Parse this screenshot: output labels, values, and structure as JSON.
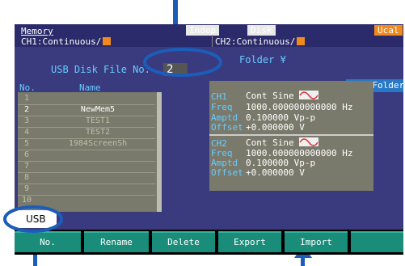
{
  "topbar": {
    "memory_label": "Memory",
    "indep_label": "Indep",
    "disk_label": "Disk",
    "ucal_label": "Ucal",
    "ch1_label": "CH1:Continuous/",
    "ch2_label": "CH2:Continuous/"
  },
  "header": {
    "title": "USB Disk File No.",
    "file_no": "2",
    "folder_label": "Folder ¥"
  },
  "file_table": {
    "col_no": "No.",
    "col_name": "Name",
    "rows": [
      {
        "no": "1",
        "name": ""
      },
      {
        "no": "2",
        "name": "NewMem5"
      },
      {
        "no": "3",
        "name": "TEST1"
      },
      {
        "no": "4",
        "name": "TEST2"
      },
      {
        "no": "5",
        "name": "1984ScreenSh"
      },
      {
        "no": "6",
        "name": ""
      },
      {
        "no": "7",
        "name": ""
      },
      {
        "no": "8",
        "name": ""
      },
      {
        "no": "9",
        "name": ""
      },
      {
        "no": "10",
        "name": ""
      }
    ]
  },
  "new_folder_label": "New Folder",
  "info": {
    "ch1": {
      "label": "CH1",
      "value": "Cont Sine"
    },
    "ch1_freq": {
      "label": "Freq",
      "value": "1000.000000000000 Hz"
    },
    "ch1_amptd": {
      "label": "Amptd",
      "value": "0.100000 Vp-p"
    },
    "ch1_offset": {
      "label": "Offset",
      "value": "+0.000000 V"
    },
    "ch2": {
      "label": "CH2",
      "value": "Cont Sine"
    },
    "ch2_freq": {
      "label": "Freq",
      "value": "1000.000000000000 Hz"
    },
    "ch2_amptd": {
      "label": "Amptd",
      "value": "0.100000 Vp-p"
    },
    "ch2_offset": {
      "label": "Offset",
      "value": "+0.000000 V"
    }
  },
  "side_label": "USB",
  "softkeys": [
    "No.",
    "Rename",
    "Delete",
    "Export",
    "Import"
  ],
  "colors": {
    "accent_arrow": "#1c5db8",
    "softkey_bg": "#1a8c7a",
    "orange": "#f08a1c",
    "new_folder_bg": "#2878c8"
  }
}
